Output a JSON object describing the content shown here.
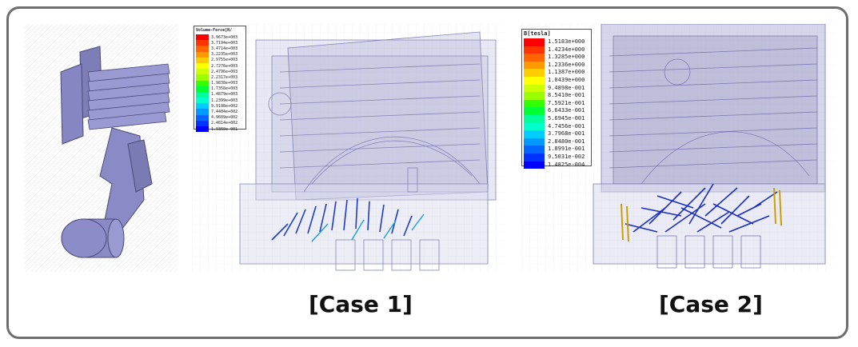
{
  "case1": {
    "caption": "[Case 1]",
    "legend": {
      "title": "Volume-Force[N/",
      "values": [
        "3.9673e+003",
        "3.7194e+003",
        "3.4714e+003",
        "3.2235e+003",
        "2.9755e+003",
        "2.7276e+003",
        "2.4796e+003",
        "2.2317e+003",
        "1.9838e+003",
        "1.7358e+003",
        "1.4879e+003",
        "1.2399e+003",
        "9.9198e+002",
        "7.4404e+002",
        "4.9609e+002",
        "2.4814e+002",
        "1.9360e-001"
      ]
    }
  },
  "case2": {
    "caption": "[Case 2]",
    "legend": {
      "title": "B[tesla]",
      "values": [
        "1.5183e+000",
        "1.4234e+000",
        "1.3285e+000",
        "1.2336e+000",
        "1.1387e+000",
        "1.0439e+000",
        "9.4898e-001",
        "8.5410e-001",
        "7.5921e-001",
        "6.6433e-001",
        "5.6945e-001",
        "4.7456e-001",
        "3.7968e-001",
        "2.8480e-001",
        "1.8991e-001",
        "9.5031e-002",
        "1.4825e-004"
      ]
    }
  },
  "colors": {
    "scale": [
      "#ff0000",
      "#ff3300",
      "#ff6600",
      "#ff9900",
      "#ffcc00",
      "#ffff00",
      "#ccff00",
      "#99ff00",
      "#33ff00",
      "#00ff33",
      "#00ff99",
      "#00ffcc",
      "#00ccff",
      "#0099ff",
      "#0066ff",
      "#0033ff",
      "#0000ff"
    ],
    "model": "#8c8cc8",
    "frame": "#6e6e6e"
  }
}
